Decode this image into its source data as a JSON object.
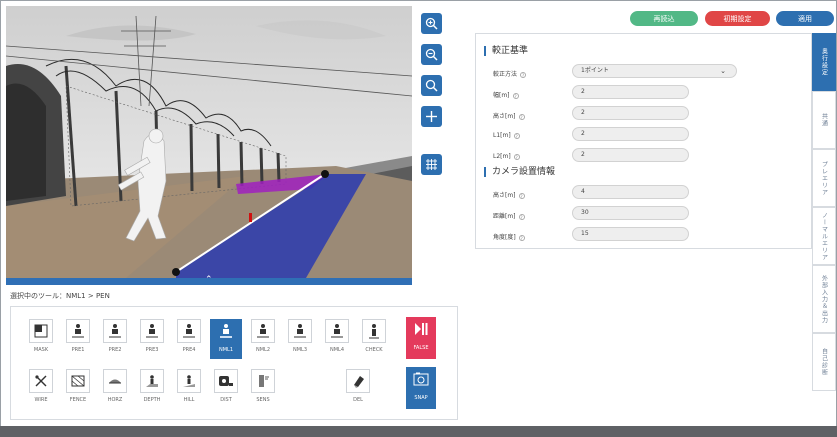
{
  "header": {
    "reload_label": "再読込",
    "reset_label": "初期設定",
    "apply_label": "適用",
    "colors": {
      "reload": "#52b886",
      "reset": "#e04646",
      "apply": "#2d6fb0"
    }
  },
  "status": {
    "current_tool": "選択中のツール：NML1 > PEN"
  },
  "tools_row1": [
    {
      "label": "MASK",
      "icon": "mask-icon"
    },
    {
      "label": "PRE1",
      "icon": "person-icon"
    },
    {
      "label": "PRE2",
      "icon": "person-icon"
    },
    {
      "label": "PRE3",
      "icon": "person-icon"
    },
    {
      "label": "PRE4",
      "icon": "person-icon"
    },
    {
      "label": "NML1",
      "icon": "person-icon",
      "selected": true
    },
    {
      "label": "NML2",
      "icon": "person-icon"
    },
    {
      "label": "NML3",
      "icon": "person-icon"
    },
    {
      "label": "NML4",
      "icon": "person-icon"
    },
    {
      "label": "CHECK",
      "icon": "check-person-icon"
    },
    {
      "label": "FALSE",
      "icon": "play-pause-icon"
    }
  ],
  "tools_row2": [
    {
      "label": "WIRE",
      "icon": "wire-icon"
    },
    {
      "label": "FENCE",
      "icon": "fence-icon"
    },
    {
      "label": "HORZ",
      "icon": "horizon-icon"
    },
    {
      "label": "DEPTH",
      "icon": "depth-icon"
    },
    {
      "label": "HILL",
      "icon": "hill-icon"
    },
    {
      "label": "DIST",
      "icon": "tape-measure-icon"
    },
    {
      "label": "SENS",
      "icon": "sensor-icon"
    },
    {
      "label": "DEL",
      "icon": "eraser-icon"
    },
    {
      "label": "SNAP",
      "icon": "camera-icon"
    }
  ],
  "calibration": {
    "title": "較正基準",
    "method_label": "較正方法",
    "method_value": "1ポイント",
    "width_label": "幅[m]",
    "width_value": "2",
    "height_label": "高さ[m]",
    "height_value": "2",
    "l1_label": "L1[m]",
    "l1_value": "2",
    "l2_label": "L2[m]",
    "l2_value": "2"
  },
  "camera_install": {
    "title": "カメラ設置情報",
    "height_label": "高さ[m]",
    "height_value": "4",
    "distance_label": "距離[m]",
    "distance_value": "30",
    "angle_label": "角度[度]",
    "angle_value": "15"
  },
  "side_tabs": [
    {
      "label": "奥行設定",
      "active": true
    },
    {
      "label": "共通"
    },
    {
      "label": "プレエリア"
    },
    {
      "label": "ノーマルエリア"
    },
    {
      "label": "外部入力＆出力"
    },
    {
      "label": "自己診断"
    }
  ]
}
